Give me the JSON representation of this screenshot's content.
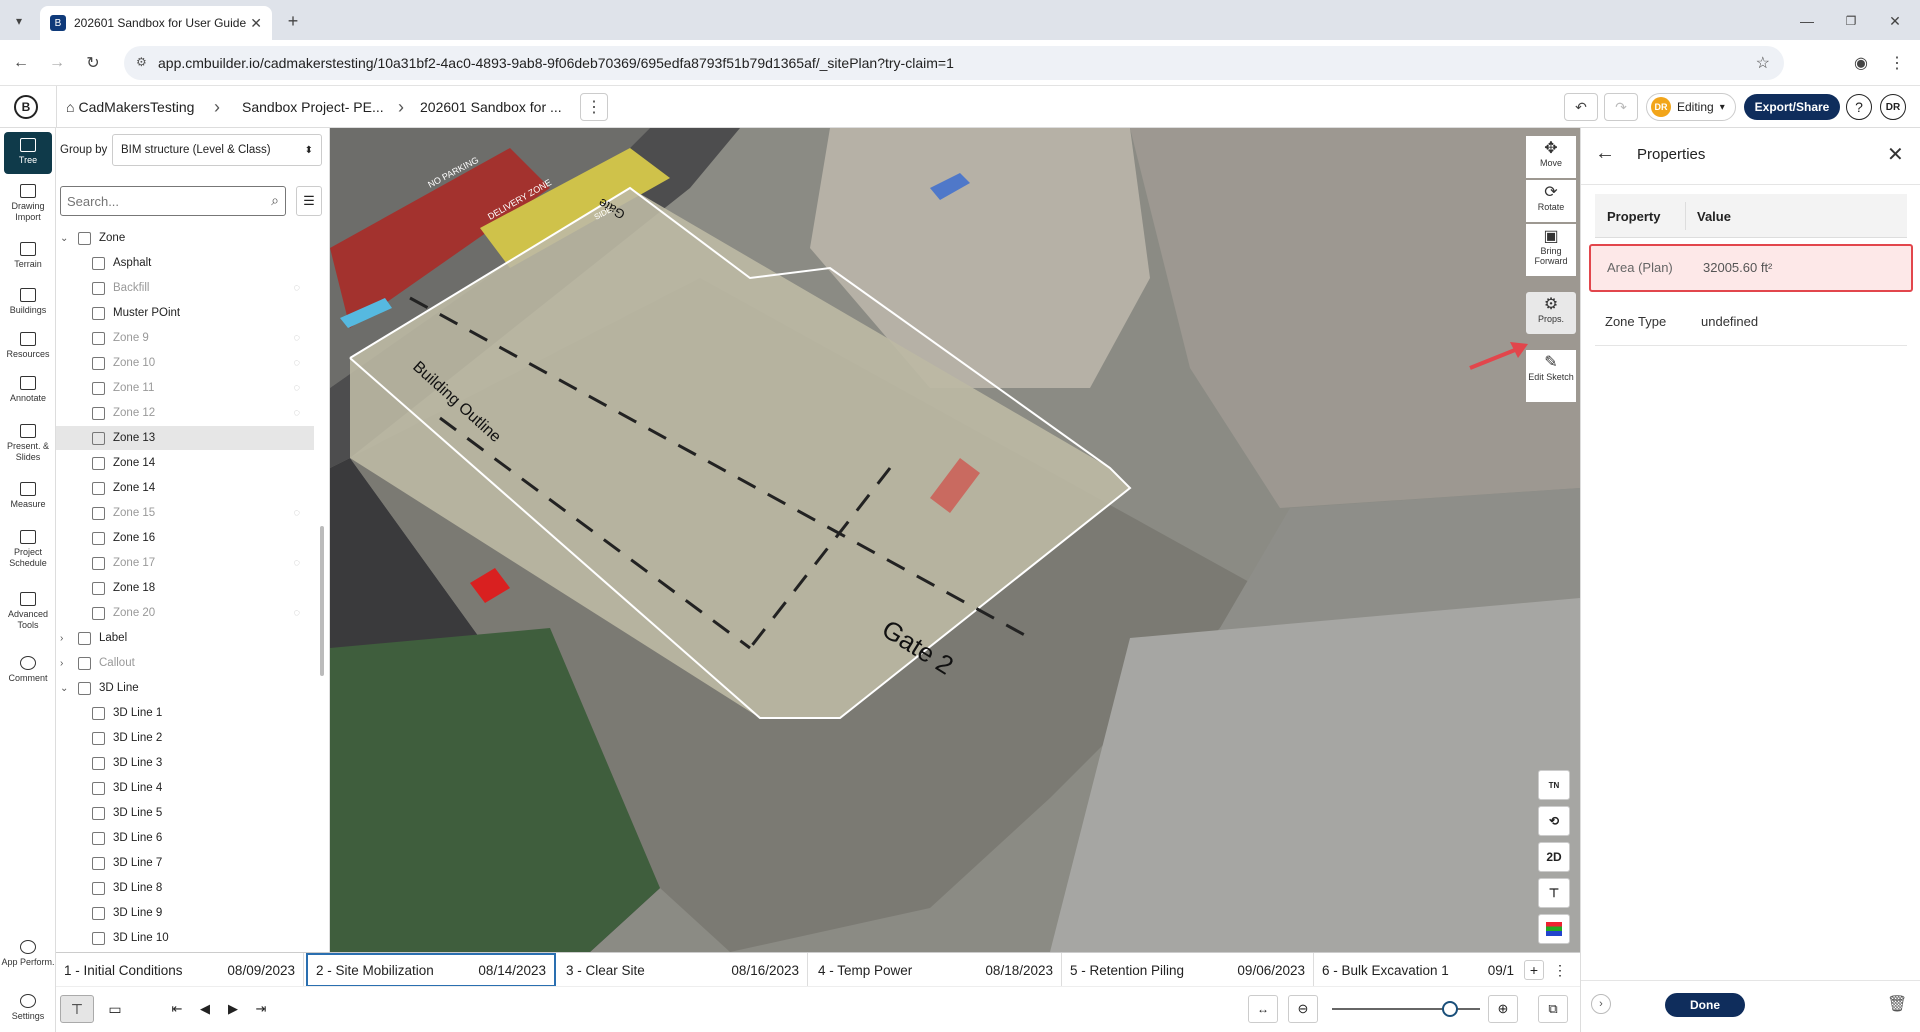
{
  "browser": {
    "tab_title": "202601 Sandbox for User Guide",
    "url": "app.cmbuilder.io/cadmakerstesting/10a31bf2-4ac0-4893-9ab8-9f06deb70369/695edfa8793f51b79d1365af/_sitePlan?try-claim=1"
  },
  "header": {
    "crumbs": [
      "CadMakersTesting",
      "Sandbox Project- PE...",
      "202601 Sandbox for ..."
    ],
    "editing_label": "Editing",
    "editing_initials": "DR",
    "export_label": "Export/Share",
    "help_label": "?",
    "avatar_initials": "DR"
  },
  "rail": {
    "items": [
      "Tree",
      "Drawing Import",
      "Terrain",
      "Buildings",
      "Resources",
      "Annotate",
      "Present. & Slides",
      "Measure",
      "Project Schedule",
      "Advanced Tools",
      "Comment"
    ],
    "bottom": [
      "App Perform.",
      "Settings"
    ]
  },
  "tree": {
    "group_by_label": "Group by",
    "group_by_value": "BIM structure (Level & Class)",
    "search_placeholder": "Search...",
    "rows": [
      {
        "label": "Zone",
        "kind": "group",
        "dim": false
      },
      {
        "label": "Asphalt",
        "kind": "item",
        "dim": false
      },
      {
        "label": "Backfill",
        "kind": "item",
        "dim": true
      },
      {
        "label": "Muster POint",
        "kind": "item",
        "dim": false
      },
      {
        "label": "Zone 9",
        "kind": "item",
        "dim": true
      },
      {
        "label": "Zone 10",
        "kind": "item",
        "dim": true
      },
      {
        "label": "Zone 11",
        "kind": "item",
        "dim": true
      },
      {
        "label": "Zone 12",
        "kind": "item",
        "dim": true
      },
      {
        "label": "Zone 13",
        "kind": "item",
        "dim": false,
        "selected": true
      },
      {
        "label": "Zone 14",
        "kind": "item",
        "dim": false
      },
      {
        "label": "Zone 14",
        "kind": "item",
        "dim": false
      },
      {
        "label": "Zone 15",
        "kind": "item",
        "dim": true
      },
      {
        "label": "Zone 16",
        "kind": "item",
        "dim": false
      },
      {
        "label": "Zone 17",
        "kind": "item",
        "dim": true
      },
      {
        "label": "Zone 18",
        "kind": "item",
        "dim": false
      },
      {
        "label": "Zone 20",
        "kind": "item",
        "dim": true
      },
      {
        "label": "Label",
        "kind": "group-collapsed",
        "dim": false
      },
      {
        "label": "Callout",
        "kind": "group-collapsed",
        "dim": true
      },
      {
        "label": "3D Line",
        "kind": "group",
        "dim": false
      },
      {
        "label": "3D Line 1",
        "kind": "item",
        "dim": false
      },
      {
        "label": "3D Line 2",
        "kind": "item",
        "dim": false
      },
      {
        "label": "3D Line 3",
        "kind": "item",
        "dim": false
      },
      {
        "label": "3D Line 4",
        "kind": "item",
        "dim": false
      },
      {
        "label": "3D Line 5",
        "kind": "item",
        "dim": false
      },
      {
        "label": "3D Line 6",
        "kind": "item",
        "dim": false
      },
      {
        "label": "3D Line 7",
        "kind": "item",
        "dim": false
      },
      {
        "label": "3D Line 8",
        "kind": "item",
        "dim": false
      },
      {
        "label": "3D Line 9",
        "kind": "item",
        "dim": false
      },
      {
        "label": "3D Line 10",
        "kind": "item",
        "dim": false
      }
    ]
  },
  "scene": {
    "labels": [
      "Building Outline",
      "Gate 2",
      "Gate",
      "DELIVERY ZONE",
      "NO PARKING",
      "SIDE"
    ]
  },
  "tools": {
    "items": [
      "Move",
      "Rotate",
      "Bring Forward",
      "Props.",
      "Edit Sketch"
    ],
    "view_controls": [
      "TN",
      "",
      "2D",
      "",
      ""
    ]
  },
  "properties": {
    "title": "Properties",
    "col_property": "Property",
    "col_value": "Value",
    "rows": [
      {
        "property": "Area (Plan)",
        "value": "32005.60 ft²",
        "highlight": true
      },
      {
        "property": "Zone Type",
        "value": "undefined",
        "highlight": false
      }
    ],
    "done_label": "Done"
  },
  "timeline": {
    "phases": [
      {
        "name": "1 - Initial Conditions",
        "date": "08/09/2023"
      },
      {
        "name": "2 - Site Mobilization",
        "date": "08/14/2023",
        "active": true
      },
      {
        "name": "3 - Clear Site",
        "date": "08/16/2023"
      },
      {
        "name": "4 - Temp Power",
        "date": "08/18/2023"
      },
      {
        "name": "5 - Retention Piling",
        "date": "09/06/2023"
      },
      {
        "name": "6 - Bulk Excavation 1",
        "date": "09/1"
      }
    ]
  },
  "colors": {
    "brand": "#0f2d5c",
    "accent_red": "#e2464c",
    "highlight_bg": "#fde8e8"
  }
}
